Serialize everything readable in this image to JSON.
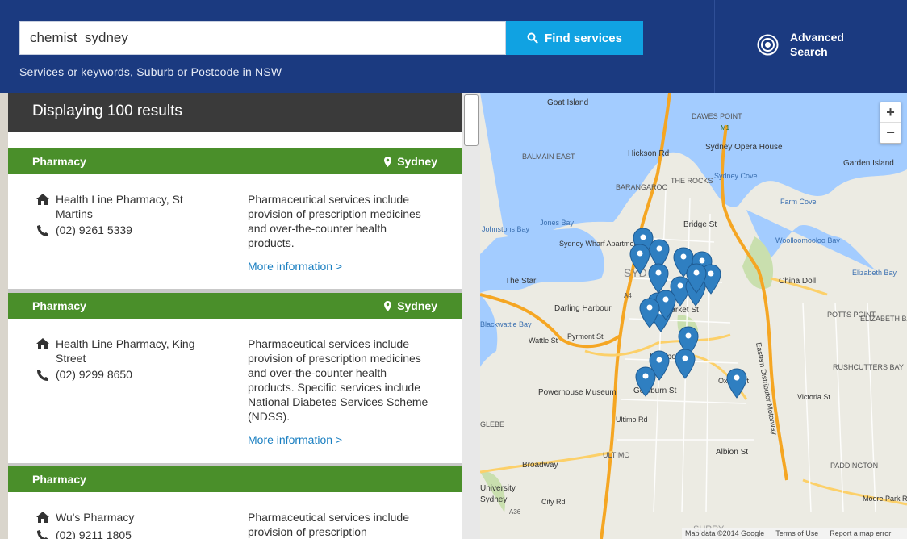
{
  "search": {
    "value": "chemist  sydney",
    "button_label": "Find services",
    "hint": "Services or keywords, Suburb or Postcode in NSW"
  },
  "advanced": {
    "line1": "Advanced",
    "line2": "Search"
  },
  "results": {
    "heading": "Displaying 100 results",
    "items": [
      {
        "category": "Pharmacy",
        "location": "Sydney",
        "name": "Health Line Pharmacy, St Martins",
        "phone": "(02) 9261 5339",
        "description": "Pharmaceutical services include provision of prescription medicines and over-the-counter health products.",
        "more": "More information >"
      },
      {
        "category": "Pharmacy",
        "location": "Sydney",
        "name": "Health Line Pharmacy, King Street",
        "phone": "(02) 9299 8650",
        "description": "Pharmaceutical services include provision of prescription medicines and over-the-counter health products. Specific services include National Diabetes Services Scheme (NDSS).",
        "more": "More information >"
      },
      {
        "category": "Pharmacy",
        "location": "",
        "name": "Wu's Pharmacy",
        "phone": "(02) 9211 1805",
        "description": "Pharmaceutical services include provision of prescription",
        "more": ""
      }
    ]
  },
  "map": {
    "labels": {
      "goat_island": "Goat Island",
      "dawes_point": "DAWES POINT",
      "m1": "M1",
      "sydney_opera_house": "Sydney Opera House",
      "sydney_cove": "Sydney Cove",
      "garden_island": "Garden Island",
      "balmain_east": "BALMAIN EAST",
      "hickson_rd": "Hickson Rd",
      "barangaroo": "BARANGAROO",
      "the_rocks": "THE ROCKS",
      "farm_cove": "Farm Cove",
      "johnstons_bay": "Johnstons Bay",
      "jones_bay": "Jones Bay",
      "bridge_st": "Bridge St",
      "sydney_wharf_apartments": "Sydney Wharf Apartments",
      "woolloomooloo_bay": "Woolloomooloo Bay",
      "elizabeth_bay_water": "Elizabeth Bay",
      "the_star": "The Star",
      "syd": "SYD",
      "china_doll": "China Doll",
      "a4": "A4",
      "darling_harbour": "Darling Harbour",
      "market_st": "Market St",
      "potts_point": "POTTS POINT",
      "elizabeth_bay": "ELIZABETH BAY",
      "blackwattle_bay": "Blackwattle Bay",
      "pyrmont_st": "Pyrmont St",
      "wattle_st": "Wattle St",
      "rushcutters_bay": "RUSHCUTTERS BAY",
      "liverpool_st": "Liverpool St",
      "powerhouse_museum": "Powerhouse Museum",
      "goulburn_st": "Goulburn St",
      "oxford_st": "Oxford St",
      "eastern_distributor": "Eastern Distributor Motorway",
      "glebe": "GLEBE",
      "ultimo_rd": "Ultimo Rd",
      "victoria_st": "Victoria St",
      "ultimo": "ULTIMO",
      "albion_st": "Albion St",
      "broadway": "Broadway",
      "paddington": "PADDINGTON",
      "surry": "SURRY",
      "a36": "A36",
      "moore_park_rd": "Moore Park Rd",
      "city_rd": "City Rd",
      "university": "University",
      "sydney": "Sydney",
      "zoom_in": "+",
      "zoom_out": "−"
    },
    "footer": {
      "data": "Map data ©2014 Google",
      "terms": "Terms of Use",
      "report": "Report a map error"
    },
    "pin_count": 20
  },
  "colors": {
    "header_bg": "#1b3a80",
    "button_bg": "#10a2e2",
    "category_bar": "#4a8f2a",
    "link": "#1a7fc1",
    "pin": "#2f7fc1"
  }
}
